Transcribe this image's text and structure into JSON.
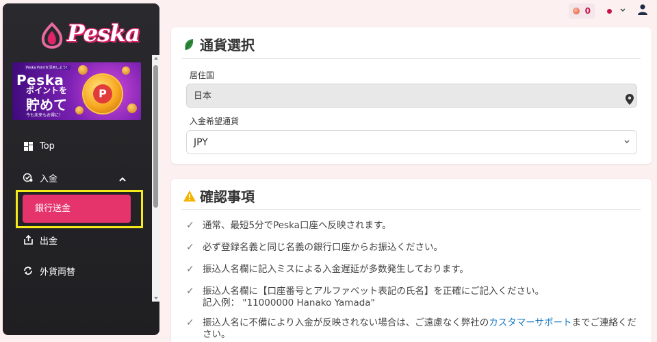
{
  "brand": {
    "logo_text": "Peska"
  },
  "banner": {
    "top_tag": "Peska Pointを活用しよう！",
    "line1": "Peska",
    "line2": "ポイントを",
    "line3": "貯めて",
    "line4": "今も未来もお得に！",
    "coin_letter": "P"
  },
  "sidebar": {
    "items": [
      {
        "label": "Top",
        "icon": "dashboard-icon"
      },
      {
        "label": "入金",
        "icon": "deposit-icon"
      },
      {
        "label": "銀行送金"
      },
      {
        "label": "出金",
        "icon": "withdraw-icon"
      },
      {
        "label": "外貨両替",
        "icon": "exchange-icon"
      }
    ]
  },
  "header": {
    "points": "0"
  },
  "currency_card": {
    "title": "通貨選択",
    "country_label": "居住国",
    "country_value": "日本",
    "currency_label": "入金希望通貨",
    "currency_value": "JPY"
  },
  "confirm_card": {
    "title": "確認事項",
    "items": [
      "通常、最短5分でPeska口座へ反映されます。",
      "必ず登録名義と同じ名義の銀行口座からお振込ください。",
      "振込人名欄に記入ミスによる入金遅延が多数発生しております。",
      "振込人名欄に【口座番号とアルファベット表記の氏名】を正確にご記入ください。",
      "記入例：  \"11000000 Hanako Yamada\"",
      "振込人名に不備により入金が反映されない場合は、ご遠慮なく弊社の",
      "カスタマーサポート",
      "までご連絡ください。"
    ]
  },
  "colors": {
    "accent": "#e5336c",
    "sidebar_bg": "#2a2a2e",
    "highlight": "#f5ea1a",
    "link": "#1a79c2"
  }
}
